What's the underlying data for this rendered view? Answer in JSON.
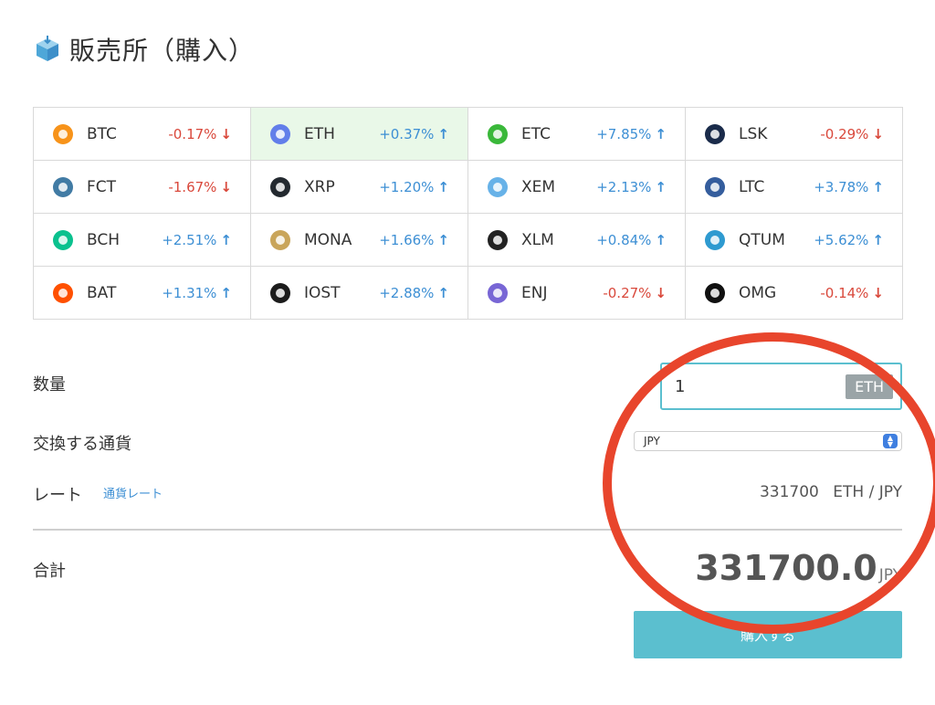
{
  "header": {
    "title": "販売所（購入）",
    "icon": "cube-icon"
  },
  "coins": [
    {
      "symbol": "BTC",
      "change": "-0.17%",
      "dir": "down",
      "icon": "btc-icon",
      "color": "#f7931a"
    },
    {
      "symbol": "ETH",
      "change": "+0.37%",
      "dir": "up",
      "icon": "eth-icon",
      "color": "#627eea",
      "selected": true
    },
    {
      "symbol": "ETC",
      "change": "+7.85%",
      "dir": "up",
      "icon": "etc-icon",
      "color": "#3ab83a"
    },
    {
      "symbol": "LSK",
      "change": "-0.29%",
      "dir": "down",
      "icon": "lsk-icon",
      "color": "#1a2b4a"
    },
    {
      "symbol": "FCT",
      "change": "-1.67%",
      "dir": "down",
      "icon": "fct-icon",
      "color": "#417ba4"
    },
    {
      "symbol": "XRP",
      "change": "+1.20%",
      "dir": "up",
      "icon": "xrp-icon",
      "color": "#23292f"
    },
    {
      "symbol": "XEM",
      "change": "+2.13%",
      "dir": "up",
      "icon": "xem-icon",
      "color": "#67b2e8"
    },
    {
      "symbol": "LTC",
      "change": "+3.78%",
      "dir": "up",
      "icon": "ltc-icon",
      "color": "#345d9d"
    },
    {
      "symbol": "BCH",
      "change": "+2.51%",
      "dir": "up",
      "icon": "bch-icon",
      "color": "#0ac18e"
    },
    {
      "symbol": "MONA",
      "change": "+1.66%",
      "dir": "up",
      "icon": "mona-icon",
      "color": "#c9a55a"
    },
    {
      "symbol": "XLM",
      "change": "+0.84%",
      "dir": "up",
      "icon": "xlm-icon",
      "color": "#222222"
    },
    {
      "symbol": "QTUM",
      "change": "+5.62%",
      "dir": "up",
      "icon": "qtum-icon",
      "color": "#2e9ad0"
    },
    {
      "symbol": "BAT",
      "change": "+1.31%",
      "dir": "up",
      "icon": "bat-icon",
      "color": "#ff5000"
    },
    {
      "symbol": "IOST",
      "change": "+2.88%",
      "dir": "up",
      "icon": "iost-icon",
      "color": "#1c1c1c"
    },
    {
      "symbol": "ENJ",
      "change": "-0.27%",
      "dir": "down",
      "icon": "enj-icon",
      "color": "#7866d5"
    },
    {
      "symbol": "OMG",
      "change": "-0.14%",
      "dir": "down",
      "icon": "omg-icon",
      "color": "#101010"
    }
  ],
  "form": {
    "quantity_label": "数量",
    "quantity_value": "1",
    "quantity_unit": "ETH",
    "exchange_label": "交換する通貨",
    "exchange_value": "JPY",
    "rate_label": "レート",
    "rate_link": "通貨レート",
    "rate_value": "331700",
    "rate_pair": "ETH / JPY",
    "total_label": "合計",
    "total_value": "331700.0",
    "total_currency": "JPY",
    "buy_button": "購入する"
  },
  "colors": {
    "up": "#3d8fd4",
    "down": "#d9483b",
    "accent": "#5bbfcf",
    "annotation": "#e8452c"
  }
}
